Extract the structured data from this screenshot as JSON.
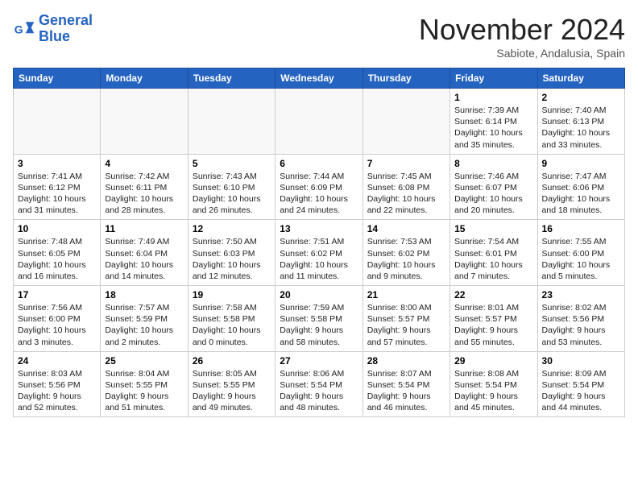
{
  "header": {
    "logo_line1": "General",
    "logo_line2": "Blue",
    "month": "November 2024",
    "location": "Sabiote, Andalusia, Spain"
  },
  "weekdays": [
    "Sunday",
    "Monday",
    "Tuesday",
    "Wednesday",
    "Thursday",
    "Friday",
    "Saturday"
  ],
  "weeks": [
    [
      {
        "day": "",
        "info": ""
      },
      {
        "day": "",
        "info": ""
      },
      {
        "day": "",
        "info": ""
      },
      {
        "day": "",
        "info": ""
      },
      {
        "day": "",
        "info": ""
      },
      {
        "day": "1",
        "info": "Sunrise: 7:39 AM\nSunset: 6:14 PM\nDaylight: 10 hours and 35 minutes."
      },
      {
        "day": "2",
        "info": "Sunrise: 7:40 AM\nSunset: 6:13 PM\nDaylight: 10 hours and 33 minutes."
      }
    ],
    [
      {
        "day": "3",
        "info": "Sunrise: 7:41 AM\nSunset: 6:12 PM\nDaylight: 10 hours and 31 minutes."
      },
      {
        "day": "4",
        "info": "Sunrise: 7:42 AM\nSunset: 6:11 PM\nDaylight: 10 hours and 28 minutes."
      },
      {
        "day": "5",
        "info": "Sunrise: 7:43 AM\nSunset: 6:10 PM\nDaylight: 10 hours and 26 minutes."
      },
      {
        "day": "6",
        "info": "Sunrise: 7:44 AM\nSunset: 6:09 PM\nDaylight: 10 hours and 24 minutes."
      },
      {
        "day": "7",
        "info": "Sunrise: 7:45 AM\nSunset: 6:08 PM\nDaylight: 10 hours and 22 minutes."
      },
      {
        "day": "8",
        "info": "Sunrise: 7:46 AM\nSunset: 6:07 PM\nDaylight: 10 hours and 20 minutes."
      },
      {
        "day": "9",
        "info": "Sunrise: 7:47 AM\nSunset: 6:06 PM\nDaylight: 10 hours and 18 minutes."
      }
    ],
    [
      {
        "day": "10",
        "info": "Sunrise: 7:48 AM\nSunset: 6:05 PM\nDaylight: 10 hours and 16 minutes."
      },
      {
        "day": "11",
        "info": "Sunrise: 7:49 AM\nSunset: 6:04 PM\nDaylight: 10 hours and 14 minutes."
      },
      {
        "day": "12",
        "info": "Sunrise: 7:50 AM\nSunset: 6:03 PM\nDaylight: 10 hours and 12 minutes."
      },
      {
        "day": "13",
        "info": "Sunrise: 7:51 AM\nSunset: 6:02 PM\nDaylight: 10 hours and 11 minutes."
      },
      {
        "day": "14",
        "info": "Sunrise: 7:53 AM\nSunset: 6:02 PM\nDaylight: 10 hours and 9 minutes."
      },
      {
        "day": "15",
        "info": "Sunrise: 7:54 AM\nSunset: 6:01 PM\nDaylight: 10 hours and 7 minutes."
      },
      {
        "day": "16",
        "info": "Sunrise: 7:55 AM\nSunset: 6:00 PM\nDaylight: 10 hours and 5 minutes."
      }
    ],
    [
      {
        "day": "17",
        "info": "Sunrise: 7:56 AM\nSunset: 6:00 PM\nDaylight: 10 hours and 3 minutes."
      },
      {
        "day": "18",
        "info": "Sunrise: 7:57 AM\nSunset: 5:59 PM\nDaylight: 10 hours and 2 minutes."
      },
      {
        "day": "19",
        "info": "Sunrise: 7:58 AM\nSunset: 5:58 PM\nDaylight: 10 hours and 0 minutes."
      },
      {
        "day": "20",
        "info": "Sunrise: 7:59 AM\nSunset: 5:58 PM\nDaylight: 9 hours and 58 minutes."
      },
      {
        "day": "21",
        "info": "Sunrise: 8:00 AM\nSunset: 5:57 PM\nDaylight: 9 hours and 57 minutes."
      },
      {
        "day": "22",
        "info": "Sunrise: 8:01 AM\nSunset: 5:57 PM\nDaylight: 9 hours and 55 minutes."
      },
      {
        "day": "23",
        "info": "Sunrise: 8:02 AM\nSunset: 5:56 PM\nDaylight: 9 hours and 53 minutes."
      }
    ],
    [
      {
        "day": "24",
        "info": "Sunrise: 8:03 AM\nSunset: 5:56 PM\nDaylight: 9 hours and 52 minutes."
      },
      {
        "day": "25",
        "info": "Sunrise: 8:04 AM\nSunset: 5:55 PM\nDaylight: 9 hours and 51 minutes."
      },
      {
        "day": "26",
        "info": "Sunrise: 8:05 AM\nSunset: 5:55 PM\nDaylight: 9 hours and 49 minutes."
      },
      {
        "day": "27",
        "info": "Sunrise: 8:06 AM\nSunset: 5:54 PM\nDaylight: 9 hours and 48 minutes."
      },
      {
        "day": "28",
        "info": "Sunrise: 8:07 AM\nSunset: 5:54 PM\nDaylight: 9 hours and 46 minutes."
      },
      {
        "day": "29",
        "info": "Sunrise: 8:08 AM\nSunset: 5:54 PM\nDaylight: 9 hours and 45 minutes."
      },
      {
        "day": "30",
        "info": "Sunrise: 8:09 AM\nSunset: 5:54 PM\nDaylight: 9 hours and 44 minutes."
      }
    ]
  ]
}
